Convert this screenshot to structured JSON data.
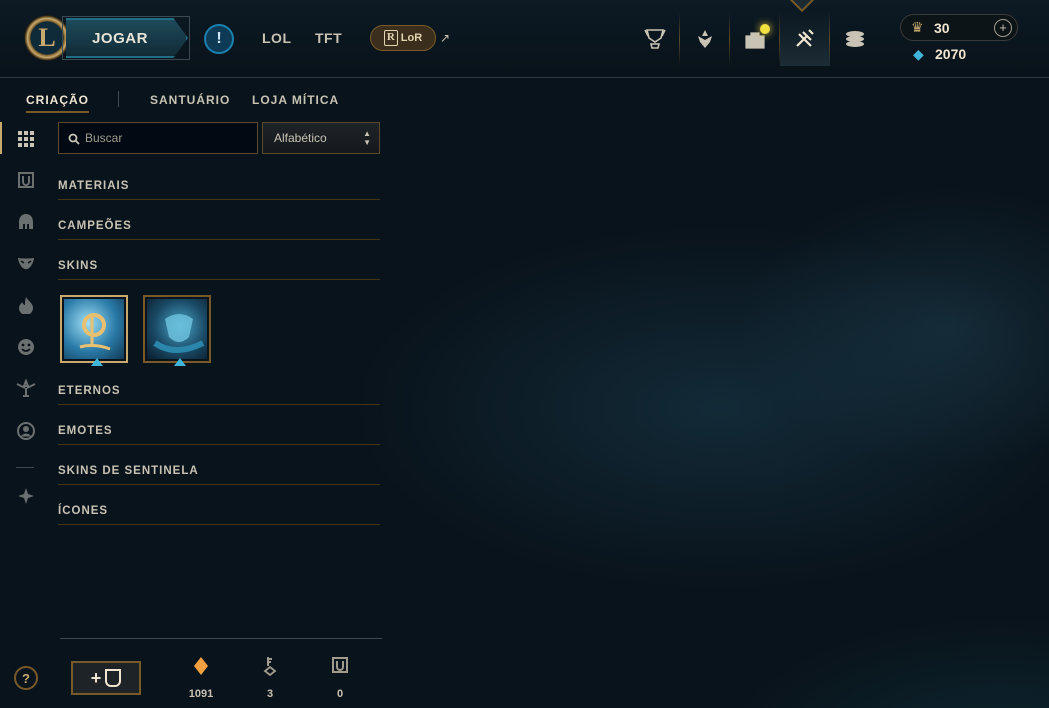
{
  "header": {
    "logo_letter": "L",
    "play_label": "JOGAR",
    "alert_symbol": "!",
    "nav": {
      "lol": "LOL",
      "tft": "TFT"
    },
    "lor": {
      "icon_letter": "R",
      "label": "LoR",
      "external_arrow": "↗"
    },
    "top_icons": [
      "trophy-icon",
      "ranked-icon",
      "store-icon",
      "loot-icon",
      "collection-coins-icon"
    ],
    "wallet": {
      "rp_value": "30",
      "add_symbol": "+",
      "be_value": "2070"
    }
  },
  "tabs": {
    "crafting": "CRIAÇÃO",
    "sanctuary": "SANTUÁRIO",
    "mythic_shop": "LOJA MÍTICA"
  },
  "filters": {
    "search_placeholder": "Buscar",
    "sort_value": "Alfabético"
  },
  "categories": {
    "materials": "MATERIAIS",
    "champions": "CAMPEÕES",
    "skins": "SKINS",
    "eternals": "ETERNOS",
    "emotes": "EMOTES",
    "ward_skins": "SKINS DE SENTINELA",
    "icons": "ÍCONES"
  },
  "skins": [
    {
      "name": "skin-shard-1"
    },
    {
      "name": "skin-shard-2"
    }
  ],
  "sidebar": [
    "all-icon",
    "chest-icon",
    "champion-icon",
    "skin-icon",
    "eternals-icon",
    "emote-icon",
    "ward-icon",
    "summoner-icon",
    "tft-icon"
  ],
  "bottom": {
    "help_symbol": "?",
    "craft_symbol": "+",
    "orange_essence": "1091",
    "keys": "3",
    "chests": "0"
  },
  "colors": {
    "gold": "#c8aa6e",
    "blue_essence": "#3fb6d9",
    "orange_essence": "#f0a040"
  }
}
